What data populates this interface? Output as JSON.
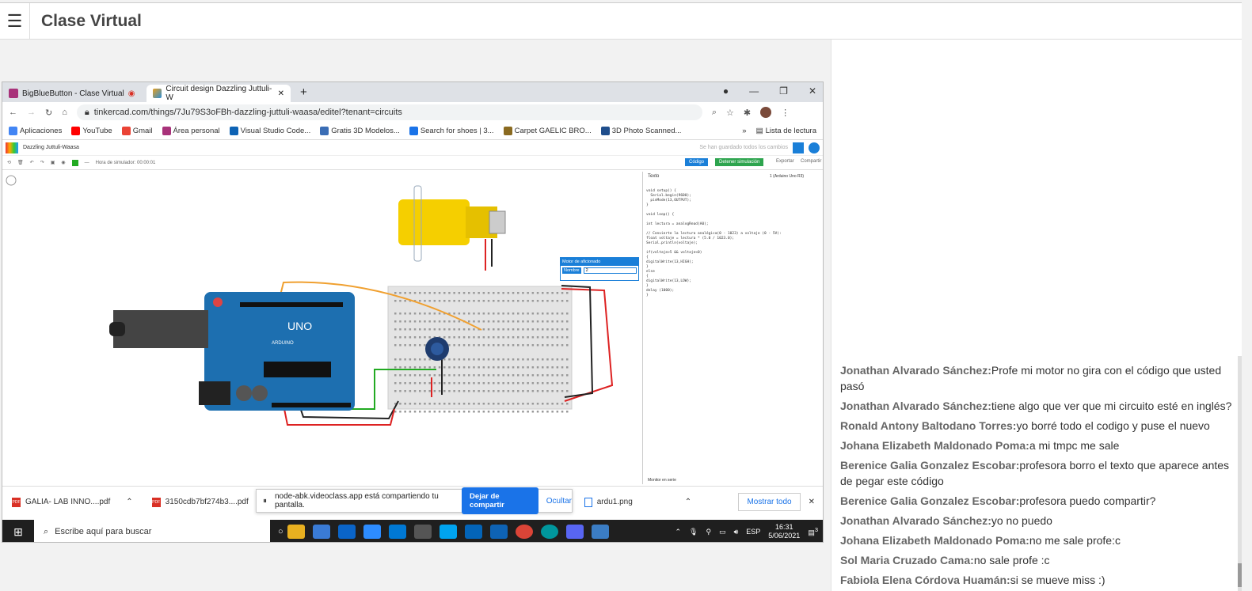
{
  "app": {
    "title": "Clase Virtual",
    "menu_icon": "hamburger-icon"
  },
  "browser": {
    "tabs": [
      {
        "label": "BigBlueButton - Clase Virtual",
        "color": "#a8327a"
      },
      {
        "label": "Circuit design Dazzling Juttuli-W",
        "color": "#e8a020"
      }
    ],
    "new_tab": "+",
    "url": "tinkercad.com/things/7Ju79S3oFBh-dazzling-juttuli-waasa/editel?tenant=circuits",
    "bookmarks": [
      "Aplicaciones",
      "YouTube",
      "Gmail",
      "Área personal",
      "Visual Studio Code...",
      "Gratis 3D Modelos...",
      "Search for shoes | 3...",
      "Carpet GAELIC BRO...",
      "3D Photo Scanned..."
    ],
    "reading_list": "Lista de lectura"
  },
  "tinkercad": {
    "project": "Dazzling Juttuli-Waasa",
    "saved_status": "Se han guardado todos los cambios",
    "sim_time": "Hora de simulador: 00:00:01",
    "code_btn": "Código",
    "stop_btn": "Detener simulación",
    "export_btn": "Exportar",
    "share_btn": "Compartir",
    "text_label": "Texto",
    "device": "1 (Arduino Uno R3)",
    "motor_panel_title": "Motor de aficionado",
    "motor_name_label": "Nombre",
    "motor_name_value": "2",
    "serial_monitor": "Monitor en serie",
    "code_text": "void setup() {\n  Serial.begin(9600);\n  pinMode(13,OUTPUT);\n}\n\nvoid loop() {\n\nint lectura = analogRead(A0);\n\n// Convierte la lectura analógica(0 - 1023) a voltaje (0 - 5V):\nfloat voltaje = lectura * (5.0 / 1023.0);\nSerial.println(voltaje);\n\nif(voltaje>5 && voltaje<0)\n{\ndigitalWrite(13,HIGH);\n}\nelse\n{\ndigitalWrite(13,LOW);\n}\ndelay (1000);\n}",
    "arduino_label": "UNO",
    "arduino_brand": "ARDUINO"
  },
  "downloads": {
    "items": [
      "GALIA- LAB INNO....pdf",
      "3150cdb7bf274b3....pdf",
      "ardu1.png"
    ],
    "show_all": "Mostrar todo"
  },
  "share_notice": {
    "text": "node-abk.videoclass.app está compartiendo tu pantalla.",
    "stop": "Dejar de compartir",
    "hide": "Ocultar"
  },
  "taskbar": {
    "search_placeholder": "Escribe aquí para buscar",
    "lang": "ESP",
    "time": "16:31",
    "date": "5/06/2021",
    "notif_count": "3"
  },
  "chat": [
    {
      "author": "Jonathan Alvarado Sánchez:",
      "text": "Profe mi motor no gira con el código que usted pasó"
    },
    {
      "author": "Jonathan Alvarado Sánchez:",
      "text": "tiene algo que ver que mi circuito esté en inglés?"
    },
    {
      "author": "Ronald Antony Baltodano Torres:",
      "text": "yo borré todo el codigo y puse el nuevo"
    },
    {
      "author": "Johana Elizabeth Maldonado Poma:",
      "text": "a mi tmpc me sale"
    },
    {
      "author": "Berenice Galia Gonzalez Escobar:",
      "text": "profesora borro el texto que aparece antes de pegar este código"
    },
    {
      "author": "Berenice Galia Gonzalez Escobar:",
      "text": "profesora puedo compartir?"
    },
    {
      "author": "Jonathan Alvarado Sánchez:",
      "text": "yo no puedo"
    },
    {
      "author": "Johana Elizabeth Maldonado Poma:",
      "text": "no me sale profe:c"
    },
    {
      "author": "Sol Maria Cruzado Cama:",
      "text": "no sale profe :c"
    },
    {
      "author": "Fabiola Elena Córdova Huamán:",
      "text": "si se mueve miss :)"
    }
  ]
}
